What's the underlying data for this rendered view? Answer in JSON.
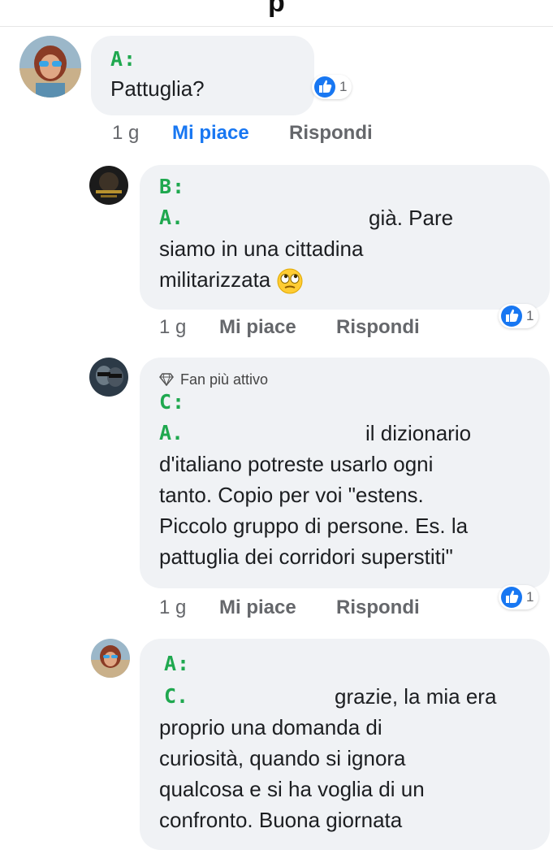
{
  "header": {
    "title_fragment": "p"
  },
  "comments": [
    {
      "speaker": "A:",
      "text": "Pattuglia?",
      "reaction_count": "1",
      "time": "1 g",
      "like_label": "Mi piace",
      "reply_label": "Rispondi"
    },
    {
      "speaker": "B:",
      "mention": "A.",
      "line1_after": "già. Pare",
      "line2": "siamo in una cittadina",
      "line3": "militarizzata",
      "reaction_count": "1",
      "time": "1 g",
      "like_label": "Mi piace",
      "reply_label": "Rispondi"
    },
    {
      "badge": "Fan più attivo",
      "speaker": "C:",
      "mention": "A.",
      "line1_after": "il dizionario",
      "line2": "d'italiano potreste usarlo ogni",
      "line3": "tanto. Copio per voi \"estens.",
      "line4": "Piccolo gruppo di persone. Es. la",
      "line5": "pattuglia dei corridori superstiti\"",
      "reaction_count": "1",
      "time": "1 g",
      "like_label": "Mi piace",
      "reply_label": "Rispondi"
    },
    {
      "speaker": "A:",
      "mention": "C.",
      "line1_after": "grazie, la mia era",
      "line2": "proprio una domanda di",
      "line3": "curiosità, quando si ignora",
      "line4": "qualcosa e si ha voglia di un",
      "line5": "confronto. Buona giornata"
    }
  ],
  "colors": {
    "speaker_green": "#1fa84f",
    "bubble_bg": "#f0f2f5",
    "like_blue": "#1877f2",
    "meta_gray": "#65676b"
  },
  "icons": [
    "like-thumb-icon",
    "diamond-icon",
    "rolling-eyes-emoji-icon"
  ]
}
